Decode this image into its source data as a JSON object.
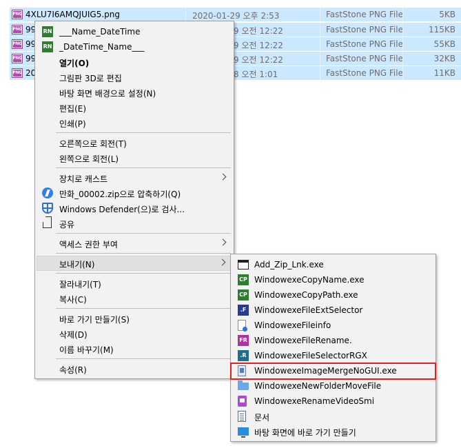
{
  "files": [
    {
      "name": "4XLU7I6AMQJUIG5.png",
      "date": "2020-01-29 오후 2:53",
      "type": "FastStone PNG File",
      "size": "5KB"
    },
    {
      "name": "99",
      "date": "9 오전 12:22",
      "type": "FastStone PNG File",
      "size": "115KB"
    },
    {
      "name": "99",
      "date": "9 오전 12:22",
      "type": "FastStone PNG File",
      "size": "55KB"
    },
    {
      "name": "99",
      "date": "9 오전 12:22",
      "type": "FastStone PNG File",
      "size": "32KB"
    },
    {
      "name": "20",
      "date": "8 오전 1:01",
      "type": "FastStone PNG File",
      "size": "11KB"
    }
  ],
  "png_icon_text": "PNG",
  "rn_icon_text": "RN",
  "context_menu": {
    "name_datetime": "___Name_DateTime",
    "datetime_name": "_DateTime_Name___",
    "open": "열기(O)",
    "edit_3d": "그림판 3D로 편집",
    "set_wallpaper": "바탕 화면 배경으로 설정(N)",
    "edit": "편집(E)",
    "print": "인쇄(P)",
    "rotate_right": "오른쪽으로 회전(T)",
    "rotate_left": "왼쪽으로 회전(L)",
    "cast": "장치로 캐스트",
    "compress": "만화_00002.zip으로 압축하기(Q)",
    "defender": "Windows Defender(으)로 검사...",
    "share": "공유",
    "give_access": "액세스 권한 부여",
    "send_to": "보내기(N)",
    "cut": "잘라내기(T)",
    "copy": "복사(C)",
    "create_shortcut": "바로 가기 만들기(S)",
    "delete": "삭제(D)",
    "rename": "이름 바꾸기(M)",
    "properties": "속성(R)"
  },
  "send_to_menu": {
    "add_zip_lnk": "Add_Zip_Lnk.exe",
    "copy_name": "WindowexeCopyName.exe",
    "copy_path": "WindowexeCopyPath.exe",
    "file_ext_selector": "WindowexeFileExtSelector",
    "file_info": "WindowexeFileinfo",
    "file_rename": "WindowexeFileRename.",
    "file_selector_rgx": "WindowexeFileSelectorRGX",
    "image_merge": "WindowexeImageMergeNoGUI.exe",
    "new_folder_move": "WindowexeNewFolderMoveFile",
    "rename_video_smi": "WindowexeRenameVideoSmi",
    "documents": "문서",
    "desktop_shortcut": "바탕 화면에 바로 가기 만들기"
  },
  "icon_badges": {
    "cp": "CP",
    "f": ".F",
    "fr": "FR",
    "r": ".R"
  },
  "colors": {
    "selection": "#cce8ff",
    "menu_bg": "#f2f2f2",
    "highlight_border": "#e02020",
    "badge_green": "#2f7d32",
    "badge_navy": "#2a3a8f",
    "badge_purple": "#b32fa8",
    "badge_teal": "#1f6f8b"
  }
}
